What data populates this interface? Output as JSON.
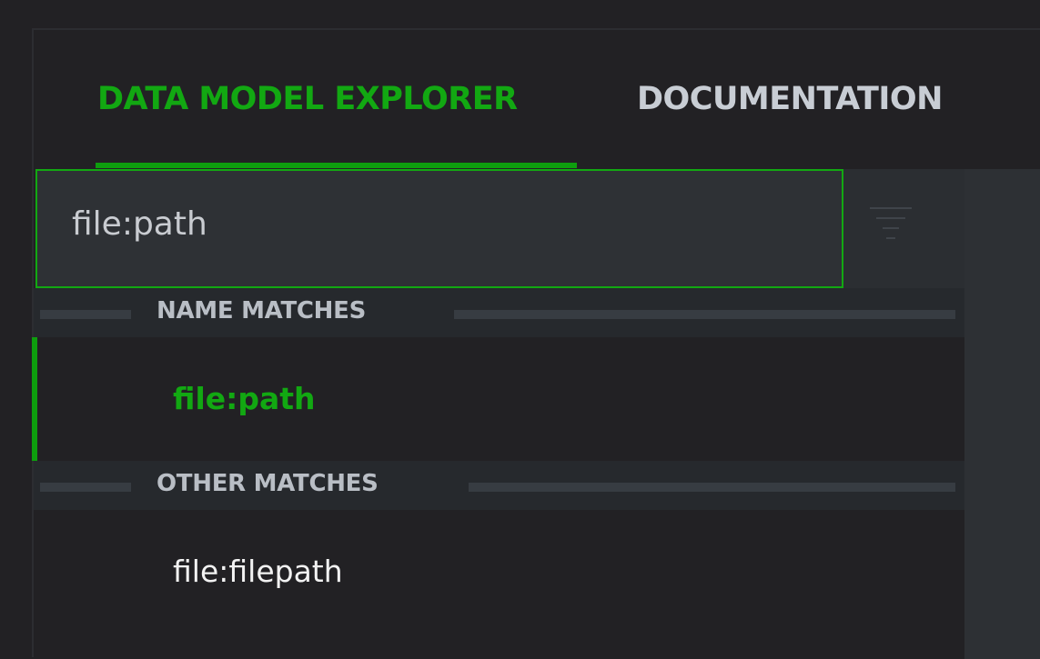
{
  "tabs": [
    {
      "label": "DATA MODEL EXPLORER",
      "active": true
    },
    {
      "label": "DOCUMENTATION",
      "active": false
    }
  ],
  "search": {
    "value": "file:path",
    "placeholder": ""
  },
  "filter": {
    "icon": "filter-icon"
  },
  "sections": {
    "name_matches": {
      "label": "NAME MATCHES",
      "items": [
        "file:path"
      ]
    },
    "other_matches": {
      "label": "OTHER MATCHES",
      "items": [
        "file:filepath"
      ]
    }
  },
  "colors": {
    "accent": "#12a812",
    "background": "#222124",
    "panel": "#2e3135",
    "muted_text": "#c8cdd4"
  }
}
